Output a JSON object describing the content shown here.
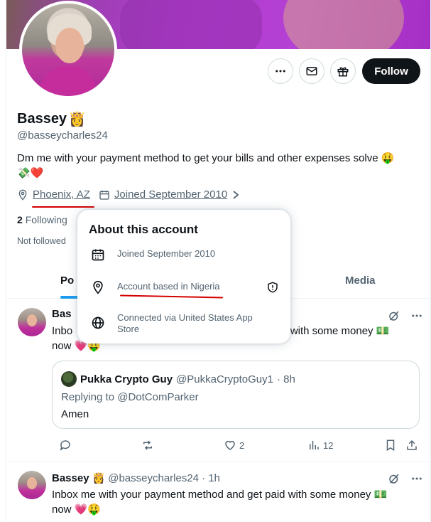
{
  "profile": {
    "name": "Bassey",
    "name_emoji": "👸",
    "handle": "@basseycharles24",
    "bio_line1": "Dm me with your payment method to get your bills and other expenses solve 🤑",
    "bio_line2": "💸❤️",
    "location": "Phoenix, AZ",
    "joined": "Joined September 2010",
    "following_count": "2",
    "following_label": "Following",
    "not_followed": "Not followed",
    "follow_label": "Follow"
  },
  "tabs": {
    "posts": "Po",
    "media": "Media"
  },
  "popup": {
    "title": "About this account",
    "joined": "Joined September 2010",
    "based": "Account based in Nigeria",
    "connected_line1": "Connected via United States App",
    "connected_line2": "Store"
  },
  "post1": {
    "name_partial": "Bas",
    "text_line1_left": "Inbo",
    "text_line1_right": "id with some money 💵",
    "text_line2": "now 💗🤑",
    "quote": {
      "name": "Pukka Crypto Guy",
      "handle": "@PukkaCryptoGuy1",
      "time": "· 8h",
      "replying": "Replying to @DotComParker",
      "text": "Amen"
    },
    "likes": "2",
    "views": "12"
  },
  "post2": {
    "name": "Bassey",
    "emoji": "👸",
    "handle": "@basseycharles24",
    "time": "· 1h",
    "text_line1": "Inbox me with your payment method and get paid with some money 💵",
    "text_line2": "now 💗🤑"
  },
  "colors": {
    "follow_bg": "#0f1419",
    "accent": "#1d9bf0",
    "annotation": "#d40000",
    "secondary_text": "#536471"
  }
}
